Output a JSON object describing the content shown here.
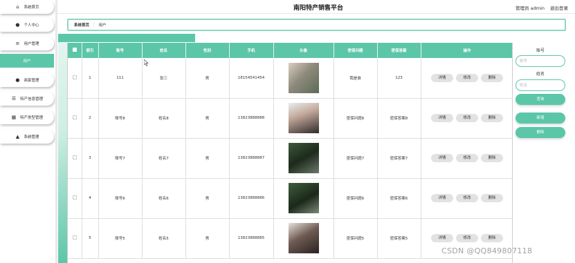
{
  "header": {
    "title": "南阳特产销售平台",
    "user_label": "管理员 admin",
    "logout_label": "退出登录"
  },
  "sidebar": {
    "items": [
      {
        "label": "系统首页",
        "icon": "home-icon"
      },
      {
        "label": "个人中心",
        "icon": "person-icon"
      },
      {
        "label": "用户管理",
        "icon": "sliders-icon"
      },
      {
        "label": "用户",
        "icon": ""
      },
      {
        "label": "商家管理",
        "icon": "person-icon"
      },
      {
        "label": "特产信息管理",
        "icon": "list-icon"
      },
      {
        "label": "特产类型管理",
        "icon": "grid-icon"
      },
      {
        "label": "系统管理",
        "icon": "thumb-icon"
      }
    ]
  },
  "breadcrumb": {
    "home": "系统首页",
    "separator": "⋮",
    "current": "用户"
  },
  "table": {
    "headers": [
      "索引",
      "账号",
      "姓名",
      "性别",
      "手机",
      "头像",
      "密保问题",
      "密保答案",
      "操作"
    ],
    "rows": [
      {
        "index": "1",
        "account": "111",
        "name": "张三",
        "gender": "男",
        "phone": "18154541454",
        "question": "我是谁",
        "answer": "123"
      },
      {
        "index": "2",
        "account": "账号8",
        "name": "姓名8",
        "gender": "男",
        "phone": "13823888888",
        "question": "密保问题8",
        "answer": "密保答案8"
      },
      {
        "index": "3",
        "account": "账号7",
        "name": "姓名7",
        "gender": "男",
        "phone": "13823888887",
        "question": "密保问题7",
        "answer": "密保答案7"
      },
      {
        "index": "4",
        "account": "账号6",
        "name": "姓名6",
        "gender": "男",
        "phone": "13823888886",
        "question": "密保问题6",
        "answer": "密保答案6"
      },
      {
        "index": "5",
        "account": "账号5",
        "name": "姓名5",
        "gender": "男",
        "phone": "13823888885",
        "question": "密保问题5",
        "answer": "密保答案5"
      }
    ],
    "actions": {
      "detail": "详情",
      "edit": "修改",
      "delete": "删除"
    }
  },
  "search_panel": {
    "account_label": "账号",
    "account_placeholder": "账号",
    "name_label": "姓名",
    "name_placeholder": "姓名",
    "search_button": "查询",
    "add_button": "新增",
    "delete_button": "删除"
  },
  "watermark": "CSDN @QQ849807118",
  "colors": {
    "accent": "#5bc6a8",
    "accent_light": "#8dd7c2"
  }
}
